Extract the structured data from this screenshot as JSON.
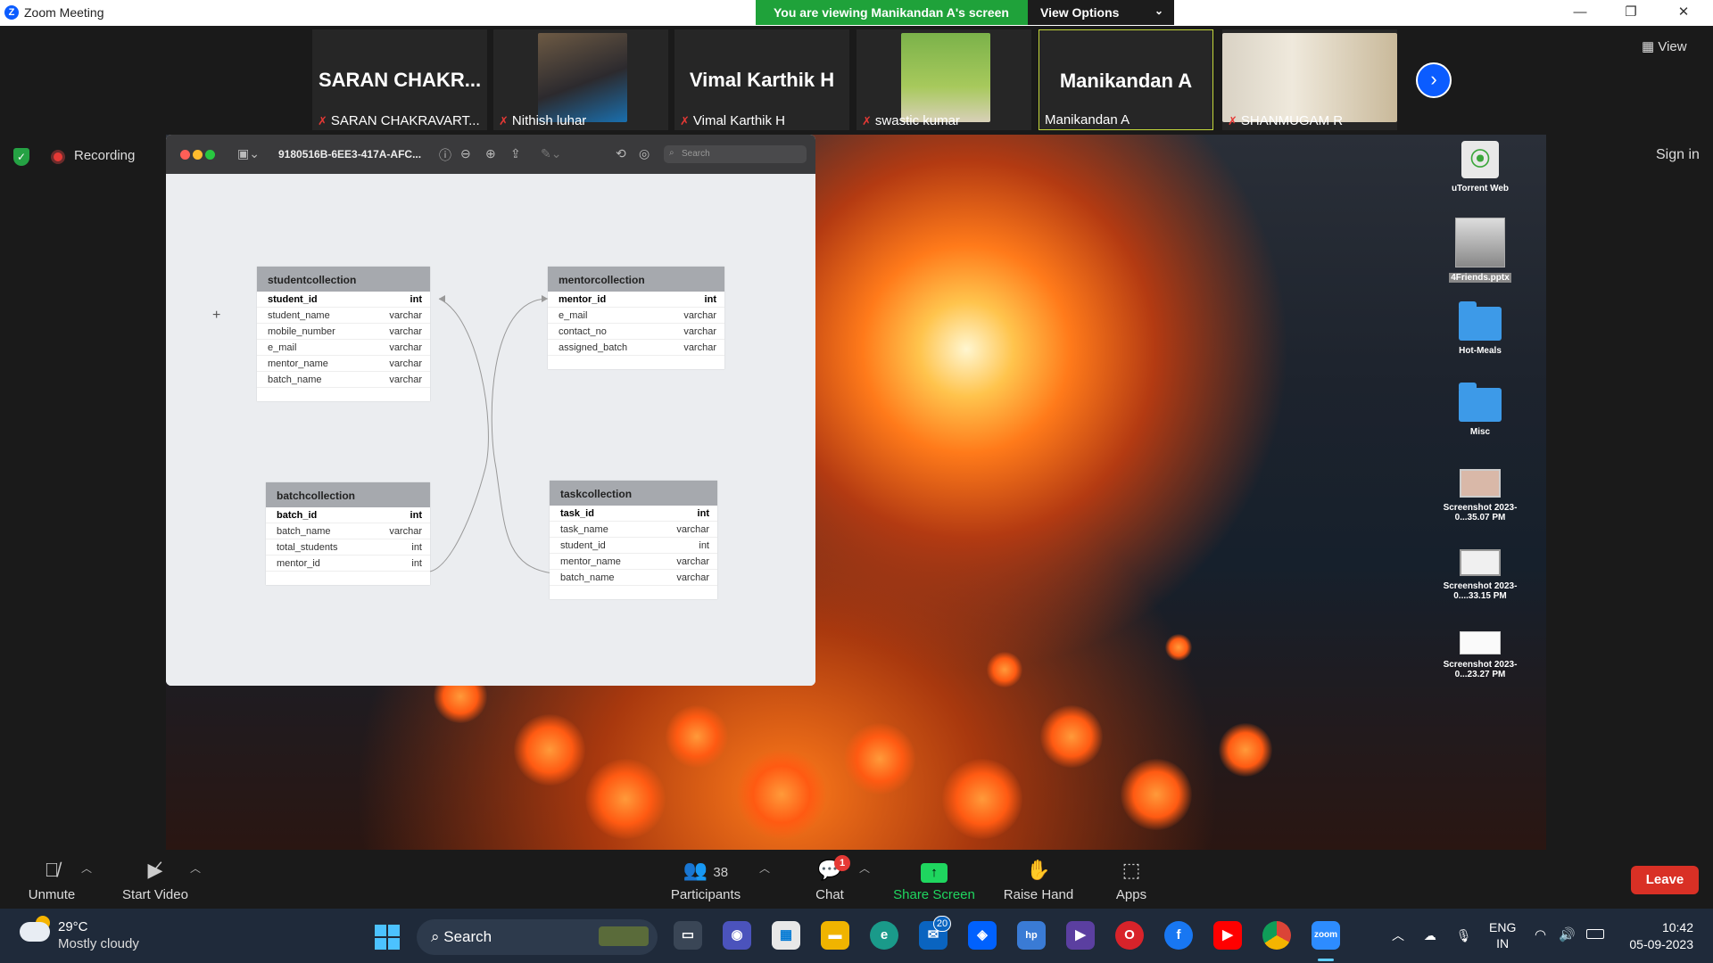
{
  "app": {
    "title": "Zoom Meeting",
    "logo_letter": "Z"
  },
  "banner": {
    "viewing_text": "You are viewing Manikandan A's screen",
    "view_options_label": "View Options"
  },
  "participants_strip": [
    {
      "big_name": "SARAN  CHAKR...",
      "label": "SARAN CHAKRAVART...",
      "muted": true,
      "has_photo": false
    },
    {
      "big_name": "",
      "label": "Nithish luhar",
      "muted": true,
      "has_photo": true
    },
    {
      "big_name": "Vimal Karthik H",
      "label": "Vimal Karthik H",
      "muted": true,
      "has_photo": false
    },
    {
      "big_name": "",
      "label": "swastic kumar",
      "muted": true,
      "has_photo": true
    },
    {
      "big_name": "Manikandan A",
      "label": "Manikandan A",
      "muted": false,
      "has_photo": false,
      "active": true
    },
    {
      "big_name": "",
      "label": "SHANMUGAM R",
      "muted": true,
      "has_photo": true
    }
  ],
  "view_label": "View",
  "recording_label": "Recording",
  "sign_in_label": "Sign in",
  "viewer": {
    "filename": "9180516B-6EE3-417A-AFC...",
    "search_placeholder": "Search"
  },
  "erd": {
    "tables": [
      {
        "name": "studentcollection",
        "rows": [
          [
            "student_id",
            "int"
          ],
          [
            "student_name",
            "varchar"
          ],
          [
            "mobile_number",
            "varchar"
          ],
          [
            "e_mail",
            "varchar"
          ],
          [
            "mentor_name",
            "varchar"
          ],
          [
            "batch_name",
            "varchar"
          ]
        ]
      },
      {
        "name": "mentorcollection",
        "rows": [
          [
            "mentor_id",
            "int"
          ],
          [
            "e_mail",
            "varchar"
          ],
          [
            "contact_no",
            "varchar"
          ],
          [
            "assigned_batch",
            "varchar"
          ]
        ]
      },
      {
        "name": "batchcollection",
        "rows": [
          [
            "batch_id",
            "int"
          ],
          [
            "batch_name",
            "varchar"
          ],
          [
            "total_students",
            "int"
          ],
          [
            "mentor_id",
            "int"
          ]
        ]
      },
      {
        "name": "taskcollection",
        "rows": [
          [
            "task_id",
            "int"
          ],
          [
            "task_name",
            "varchar"
          ],
          [
            "student_id",
            "int"
          ],
          [
            "mentor_name",
            "varchar"
          ],
          [
            "batch_name",
            "varchar"
          ]
        ]
      }
    ]
  },
  "desktop_icons": [
    {
      "label": "uTorrent Web",
      "icon": "utorrent-icon"
    },
    {
      "label": "4Friends.pptx",
      "icon": "pptx-thumbnail-icon"
    },
    {
      "label": "Hot-Meals",
      "icon": "folder-icon"
    },
    {
      "label": "Misc",
      "icon": "folder-icon"
    },
    {
      "label": "Screenshot 2023-0...35.07 PM",
      "icon": "screenshot-icon"
    },
    {
      "label": "Screenshot 2023-0....33.15 PM",
      "icon": "screenshot-icon"
    },
    {
      "label": "Screenshot 2023-0...23.27 PM",
      "icon": "screenshot-icon"
    }
  ],
  "toolbar": {
    "unmute": "Unmute",
    "start_video": "Start Video",
    "participants": "Participants",
    "participants_count": "38",
    "chat": "Chat",
    "chat_badge": "1",
    "share_screen": "Share Screen",
    "raise_hand": "Raise Hand",
    "apps": "Apps",
    "leave": "Leave"
  },
  "taskbar": {
    "temperature": "29°C",
    "condition": "Mostly cloudy",
    "search_label": "Search",
    "mail_badge": "20",
    "lang_top": "ENG",
    "lang_bottom": "IN",
    "time": "10:42",
    "date": "05-09-2023"
  },
  "colors": {
    "zoom_blue": "#0b5cff",
    "banner_green": "#1fa23a",
    "leave_red": "#d93025",
    "share_green": "#1fd65f"
  }
}
